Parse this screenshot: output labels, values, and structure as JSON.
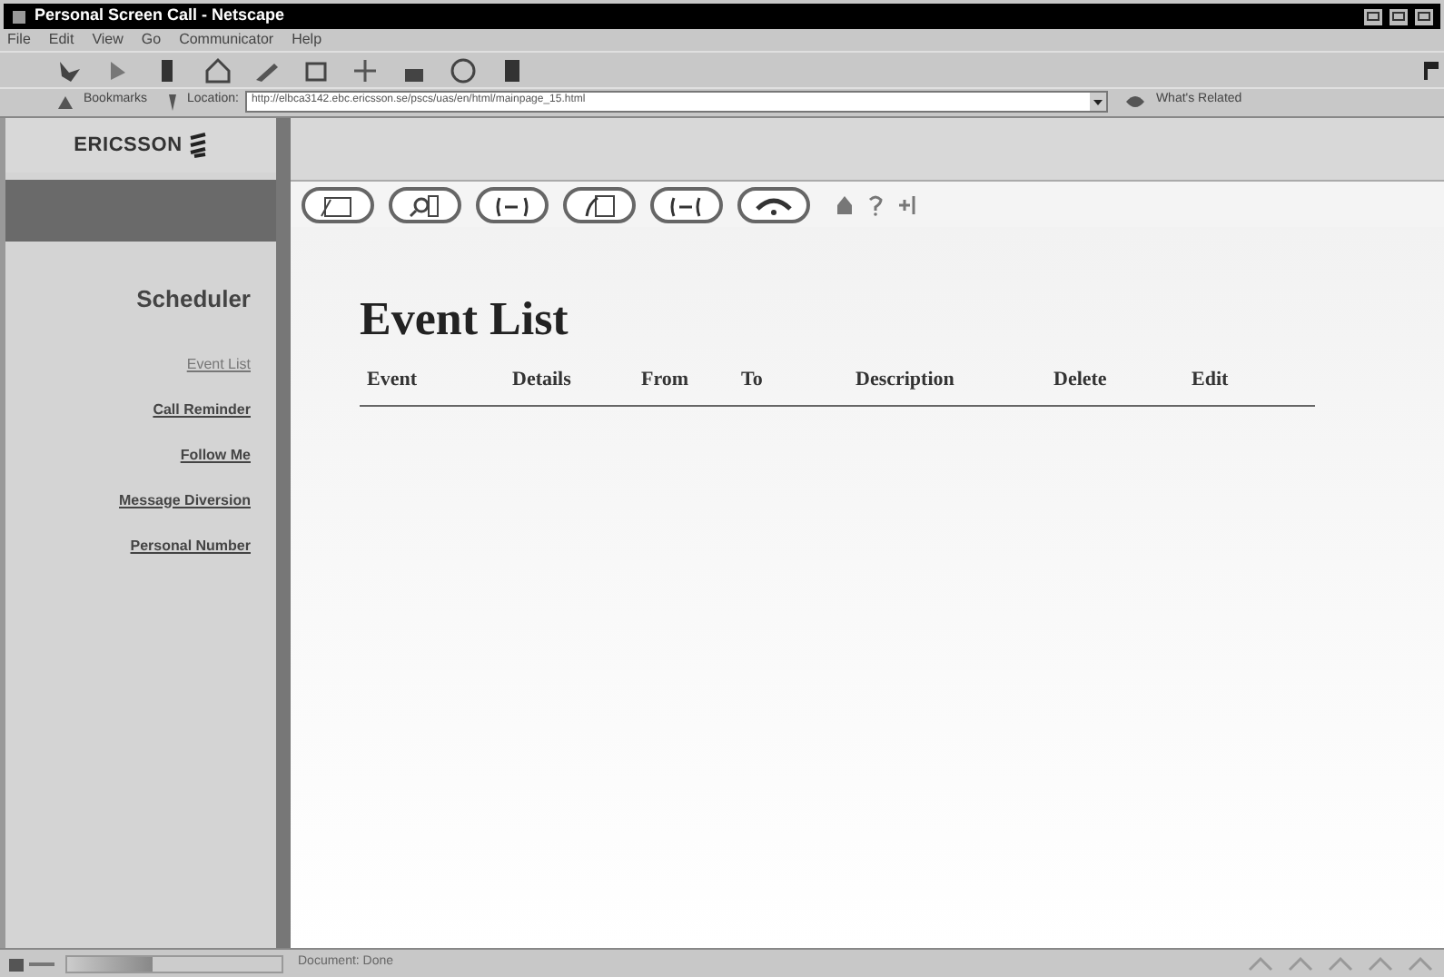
{
  "window": {
    "title": "Personal Screen Call - Netscape"
  },
  "menu": [
    "File",
    "Edit",
    "View",
    "Go",
    "Communicator",
    "Help"
  ],
  "location_bar": {
    "bookmarks": "Bookmarks",
    "label": "Location:",
    "url": "http://elbca3142.ebc.ericsson.se/pscs/uas/en/html/mainpage_15.html",
    "related": "What's Related"
  },
  "logo": "ERICSSON",
  "sidebar": {
    "heading": "Scheduler",
    "items": [
      {
        "label": "Event List",
        "selected": true
      },
      {
        "label": "Call Reminder",
        "selected": false
      },
      {
        "label": "Follow Me",
        "selected": false
      },
      {
        "label": "Message Diversion",
        "selected": false
      },
      {
        "label": "Personal Number",
        "selected": false
      }
    ]
  },
  "page": {
    "title": "Event List",
    "table": {
      "columns": [
        "Event",
        "Details",
        "From",
        "To",
        "Description",
        "Delete",
        "Edit"
      ]
    }
  },
  "progress": {
    "level": 0.4
  },
  "status_bar": "Document: Done"
}
